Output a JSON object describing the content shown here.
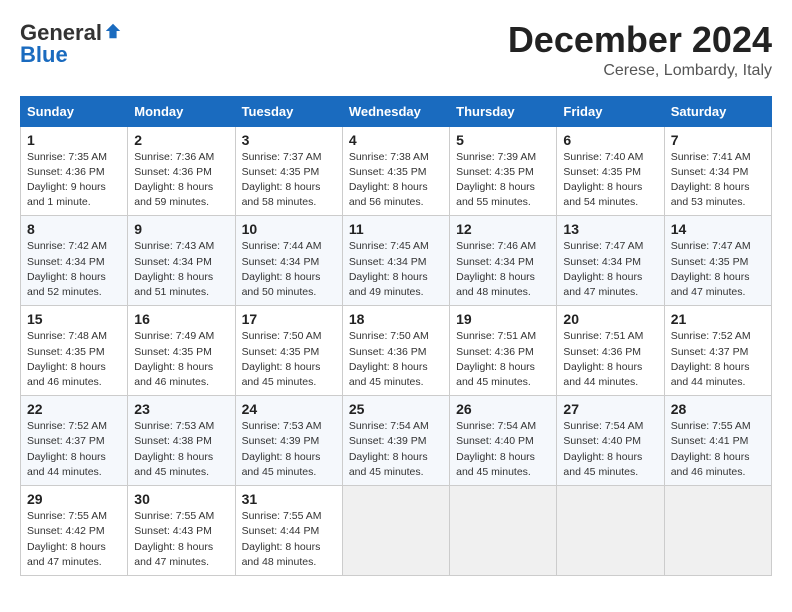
{
  "logo": {
    "general": "General",
    "blue": "Blue"
  },
  "header": {
    "month": "December 2024",
    "location": "Cerese, Lombardy, Italy"
  },
  "weekdays": [
    "Sunday",
    "Monday",
    "Tuesday",
    "Wednesday",
    "Thursday",
    "Friday",
    "Saturday"
  ],
  "weeks": [
    [
      {
        "day": "1",
        "sunrise": "7:35 AM",
        "sunset": "4:36 PM",
        "daylight": "9 hours and 1 minute."
      },
      {
        "day": "2",
        "sunrise": "7:36 AM",
        "sunset": "4:36 PM",
        "daylight": "8 hours and 59 minutes."
      },
      {
        "day": "3",
        "sunrise": "7:37 AM",
        "sunset": "4:35 PM",
        "daylight": "8 hours and 58 minutes."
      },
      {
        "day": "4",
        "sunrise": "7:38 AM",
        "sunset": "4:35 PM",
        "daylight": "8 hours and 56 minutes."
      },
      {
        "day": "5",
        "sunrise": "7:39 AM",
        "sunset": "4:35 PM",
        "daylight": "8 hours and 55 minutes."
      },
      {
        "day": "6",
        "sunrise": "7:40 AM",
        "sunset": "4:35 PM",
        "daylight": "8 hours and 54 minutes."
      },
      {
        "day": "7",
        "sunrise": "7:41 AM",
        "sunset": "4:34 PM",
        "daylight": "8 hours and 53 minutes."
      }
    ],
    [
      {
        "day": "8",
        "sunrise": "7:42 AM",
        "sunset": "4:34 PM",
        "daylight": "8 hours and 52 minutes."
      },
      {
        "day": "9",
        "sunrise": "7:43 AM",
        "sunset": "4:34 PM",
        "daylight": "8 hours and 51 minutes."
      },
      {
        "day": "10",
        "sunrise": "7:44 AM",
        "sunset": "4:34 PM",
        "daylight": "8 hours and 50 minutes."
      },
      {
        "day": "11",
        "sunrise": "7:45 AM",
        "sunset": "4:34 PM",
        "daylight": "8 hours and 49 minutes."
      },
      {
        "day": "12",
        "sunrise": "7:46 AM",
        "sunset": "4:34 PM",
        "daylight": "8 hours and 48 minutes."
      },
      {
        "day": "13",
        "sunrise": "7:47 AM",
        "sunset": "4:34 PM",
        "daylight": "8 hours and 47 minutes."
      },
      {
        "day": "14",
        "sunrise": "7:47 AM",
        "sunset": "4:35 PM",
        "daylight": "8 hours and 47 minutes."
      }
    ],
    [
      {
        "day": "15",
        "sunrise": "7:48 AM",
        "sunset": "4:35 PM",
        "daylight": "8 hours and 46 minutes."
      },
      {
        "day": "16",
        "sunrise": "7:49 AM",
        "sunset": "4:35 PM",
        "daylight": "8 hours and 46 minutes."
      },
      {
        "day": "17",
        "sunrise": "7:50 AM",
        "sunset": "4:35 PM",
        "daylight": "8 hours and 45 minutes."
      },
      {
        "day": "18",
        "sunrise": "7:50 AM",
        "sunset": "4:36 PM",
        "daylight": "8 hours and 45 minutes."
      },
      {
        "day": "19",
        "sunrise": "7:51 AM",
        "sunset": "4:36 PM",
        "daylight": "8 hours and 45 minutes."
      },
      {
        "day": "20",
        "sunrise": "7:51 AM",
        "sunset": "4:36 PM",
        "daylight": "8 hours and 44 minutes."
      },
      {
        "day": "21",
        "sunrise": "7:52 AM",
        "sunset": "4:37 PM",
        "daylight": "8 hours and 44 minutes."
      }
    ],
    [
      {
        "day": "22",
        "sunrise": "7:52 AM",
        "sunset": "4:37 PM",
        "daylight": "8 hours and 44 minutes."
      },
      {
        "day": "23",
        "sunrise": "7:53 AM",
        "sunset": "4:38 PM",
        "daylight": "8 hours and 45 minutes."
      },
      {
        "day": "24",
        "sunrise": "7:53 AM",
        "sunset": "4:39 PM",
        "daylight": "8 hours and 45 minutes."
      },
      {
        "day": "25",
        "sunrise": "7:54 AM",
        "sunset": "4:39 PM",
        "daylight": "8 hours and 45 minutes."
      },
      {
        "day": "26",
        "sunrise": "7:54 AM",
        "sunset": "4:40 PM",
        "daylight": "8 hours and 45 minutes."
      },
      {
        "day": "27",
        "sunrise": "7:54 AM",
        "sunset": "4:40 PM",
        "daylight": "8 hours and 45 minutes."
      },
      {
        "day": "28",
        "sunrise": "7:55 AM",
        "sunset": "4:41 PM",
        "daylight": "8 hours and 46 minutes."
      }
    ],
    [
      {
        "day": "29",
        "sunrise": "7:55 AM",
        "sunset": "4:42 PM",
        "daylight": "8 hours and 47 minutes."
      },
      {
        "day": "30",
        "sunrise": "7:55 AM",
        "sunset": "4:43 PM",
        "daylight": "8 hours and 47 minutes."
      },
      {
        "day": "31",
        "sunrise": "7:55 AM",
        "sunset": "4:44 PM",
        "daylight": "8 hours and 48 minutes."
      },
      null,
      null,
      null,
      null
    ]
  ],
  "labels": {
    "sunrise": "Sunrise:",
    "sunset": "Sunset:",
    "daylight": "Daylight hours"
  }
}
